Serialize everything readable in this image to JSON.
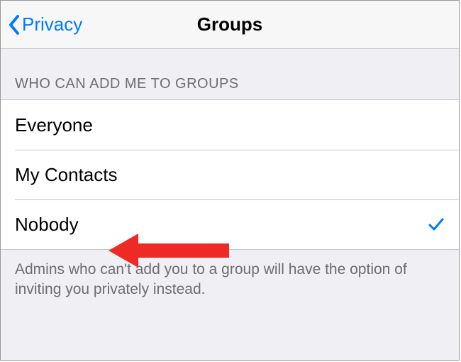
{
  "navbar": {
    "back_label": "Privacy",
    "title": "Groups"
  },
  "section": {
    "header": "WHO CAN ADD ME TO GROUPS",
    "footer": "Admins who can't add you to a group will have the option of inviting you privately instead."
  },
  "options": {
    "everyone": "Everyone",
    "my_contacts": "My Contacts",
    "nobody": "Nobody",
    "selected": "nobody"
  }
}
